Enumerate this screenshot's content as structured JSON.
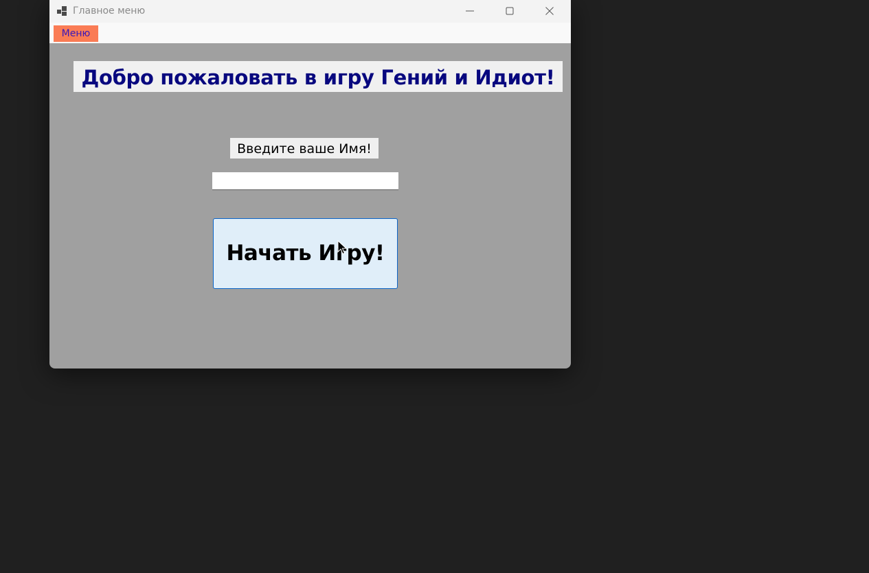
{
  "window": {
    "title": "Главное меню",
    "icon": "app-window-icon",
    "background": "#a0a0a0"
  },
  "caption_buttons": {
    "minimize_icon": "minimize-icon",
    "maximize_icon": "maximize-icon",
    "close_icon": "close-icon"
  },
  "menubar": {
    "items": [
      {
        "label": "Меню",
        "background": "#fa7c55",
        "color": "#3a18b8"
      }
    ]
  },
  "main": {
    "welcome_text": "Добро пожаловать в игру Гений и Идиот!",
    "welcome_color": "#08087f",
    "name_prompt": "Введите ваше Имя!",
    "name_input_value": "",
    "start_button_label": "Начать Игру!",
    "start_button_background": "#e0eef9",
    "start_button_border": "#0a64c8"
  }
}
